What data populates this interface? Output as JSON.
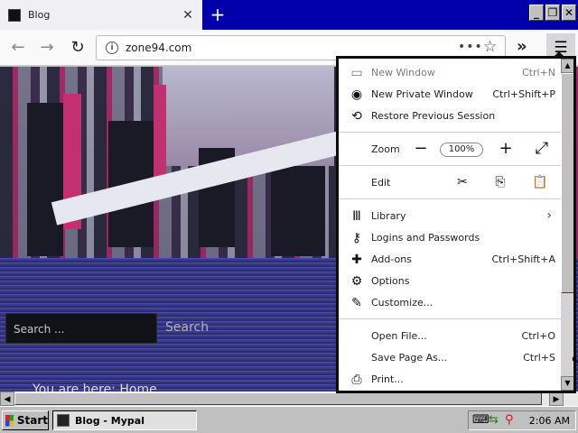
{
  "tab": {
    "title": "Blog",
    "close": "✕",
    "new_tab": "+"
  },
  "window_controls": {
    "minimize": "_",
    "restore": "❐",
    "close": "✕"
  },
  "navbar": {
    "back": "←",
    "forward": "→",
    "reload": "↻",
    "url": "zone94.com",
    "page_actions": "•••",
    "bookmark": "☆",
    "overflow": "»",
    "menu": "☰"
  },
  "page": {
    "search_placeholder": "Search ...",
    "search_button": "Search",
    "breadcrumb": "You are here:  Home"
  },
  "menu": {
    "new_window": {
      "label": "New Window",
      "shortcut": "Ctrl+N"
    },
    "private_window": {
      "label": "New Private Window",
      "shortcut": "Ctrl+Shift+P"
    },
    "restore_session": {
      "label": "Restore Previous Session"
    },
    "zoom": {
      "label": "Zoom",
      "minus": "−",
      "value": "100%",
      "plus": "+",
      "fullscreen": "⤢"
    },
    "edit": {
      "label": "Edit",
      "cut": "✂",
      "copy": "⎘",
      "paste": "📋"
    },
    "library": {
      "label": "Library",
      "chevron": "›"
    },
    "logins": {
      "label": "Logins and Passwords"
    },
    "addons": {
      "label": "Add-ons",
      "shortcut": "Ctrl+Shift+A"
    },
    "options": {
      "label": "Options"
    },
    "customize": {
      "label": "Customize..."
    },
    "open_file": {
      "label": "Open File...",
      "shortcut": "Ctrl+O"
    },
    "save_page": {
      "label": "Save Page As...",
      "shortcut": "Ctrl+S"
    },
    "print": {
      "label": "Print..."
    }
  },
  "taskbar": {
    "start": "Start",
    "task": "Blog - Mypal",
    "clock": "2:06 AM"
  }
}
